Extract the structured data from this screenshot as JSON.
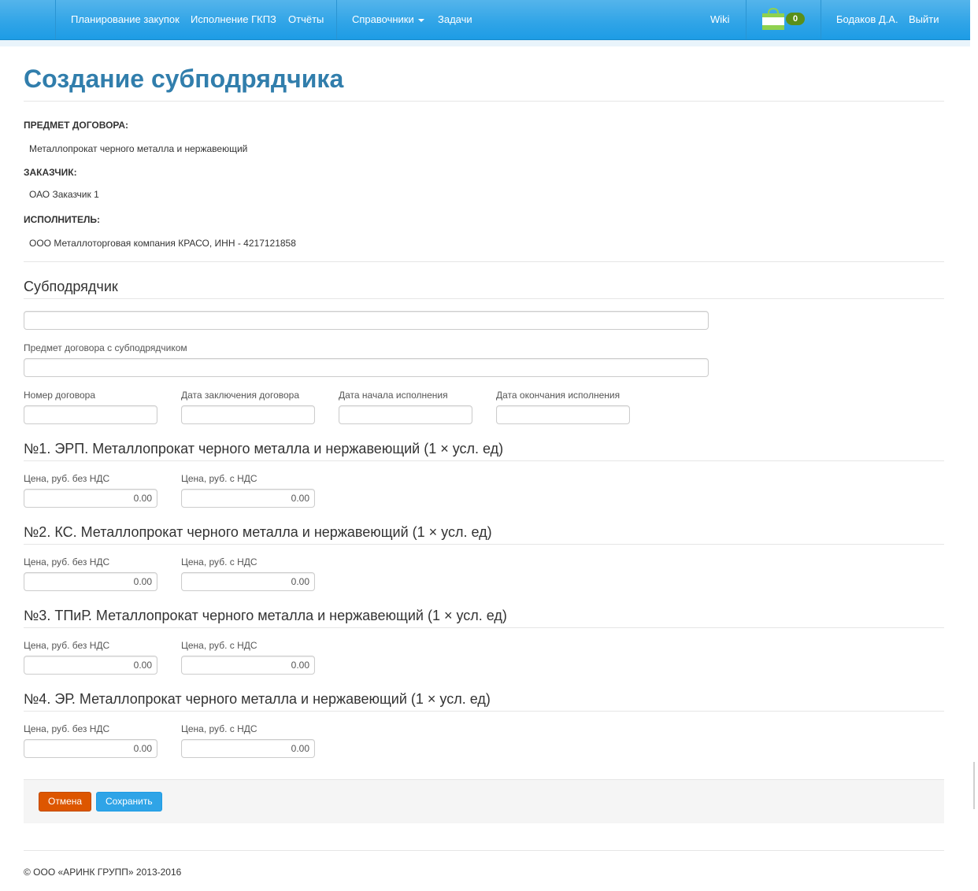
{
  "navbar": {
    "items": [
      "Планирование закупок",
      "Исполнение ГКПЗ",
      "Отчёты",
      "Справочники",
      "Задачи"
    ],
    "wiki": "Wiki",
    "cart_count": "0",
    "user": "Бодаков Д.А.",
    "logout": "Выйти"
  },
  "page": {
    "title": "Создание субподрядчика"
  },
  "details": {
    "subject_label": "ПРЕДМЕТ ДОГОВОРА:",
    "subject_value": "Металлопрокат черного металла и нержавеющий",
    "customer_label": "ЗАКАЗЧИК:",
    "customer_value": "ОАО Заказчик 1",
    "executor_label": "ИСПОЛНИТЕЛЬ:",
    "executor_value": "ООО Металлоторговая компания КРАСО, ИНН - 4217121858"
  },
  "subcontractor": {
    "heading": "Субподрядчик",
    "name_value": "",
    "subject_label": "Предмет договора с субподрядчиком",
    "subject_value": "",
    "contract_number_label": "Номер договора",
    "contract_date_label": "Дата заключения договора",
    "start_date_label": "Дата начала исполнения",
    "end_date_label": "Дата окончания исполнения"
  },
  "positions": [
    {
      "title": "№1. ЭРП. Металлопрокат черного металла и нержавеющий (1 × усл. ед)",
      "price_no_vat_label": "Цена, руб. без НДС",
      "price_vat_label": "Цена, руб. с НДС",
      "price_no_vat": "0.00",
      "price_vat": "0.00"
    },
    {
      "title": "№2. КС. Металлопрокат черного металла и нержавеющий (1 × усл. ед)",
      "price_no_vat_label": "Цена, руб. без НДС",
      "price_vat_label": "Цена, руб. с НДС",
      "price_no_vat": "0.00",
      "price_vat": "0.00"
    },
    {
      "title": "№3. ТПиР. Металлопрокат черного металла и нержавеющий (1 × усл. ед)",
      "price_no_vat_label": "Цена, руб. без НДС",
      "price_vat_label": "Цена, руб. с НДС",
      "price_no_vat": "0.00",
      "price_vat": "0.00"
    },
    {
      "title": "№4. ЭР. Металлопрокат черного металла и нержавеющий (1 × усл. ед)",
      "price_no_vat_label": "Цена, руб. без НДС",
      "price_vat_label": "Цена, руб. с НДС",
      "price_no_vat": "0.00",
      "price_vat": "0.00"
    }
  ],
  "actions": {
    "cancel": "Отмена",
    "save": "Сохранить"
  },
  "footer": {
    "copyright": "© ООО «АРИНК ГРУПП» 2013-2016"
  },
  "colors": {
    "navbar": "#2fa4e7",
    "title": "#317eac",
    "cancel": "#dd5600",
    "save": "#2fa4e7",
    "badge": "#5a8f1a"
  }
}
